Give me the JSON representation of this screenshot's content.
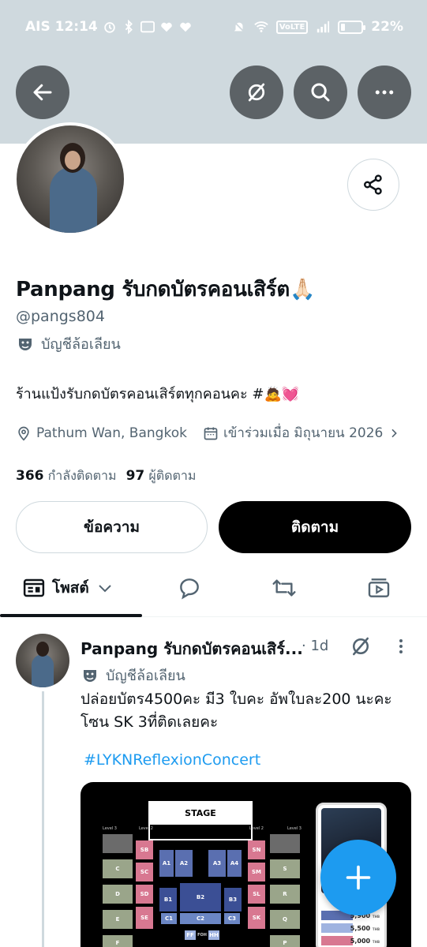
{
  "status_bar": {
    "carrier_time": "AIS 12:14",
    "battery": "22%",
    "battery_level": 0.22,
    "volte": "VoLTE"
  },
  "header": {
    "back_icon": "arrow-left-icon",
    "grok_icon": "grok-slash-icon",
    "search_icon": "search-icon",
    "more_icon": "more-horizontal-icon",
    "banner_color": "#cfd9de"
  },
  "profile": {
    "name": "Panpang รับกดบัตรคอนเสิร์ต🙏🏻",
    "handle": "@pangs804",
    "parody_label": "บัญชีล้อเลียน",
    "bio": "ร้านแป้งรับกดบัตรคอนเสิร์ตทุกคอนคะ #🙇💓",
    "location": "Pathum Wan, Bangkok",
    "joined": "เข้าร่วมเมื่อ มิถุนายน 2026",
    "following_count": "366",
    "following_label": "กำลังติดตาม",
    "followers_count": "97",
    "followers_label": "ผู้ติดตาม",
    "message_button": "ข้อความ",
    "follow_button": "ติดตาม"
  },
  "tabs": {
    "posts_label": "โพสต์"
  },
  "post": {
    "author": "Panpang รับกดบัตรคอนเสิร์...",
    "time": "· 1d",
    "parody_label": "บัญชีล้อเลียน",
    "text": "ปล่อยบัตร4500คะ มี3 ใบคะ อัพใบละ200 นะคะโซน SK 3ที่ติดเลยคะ",
    "hashtag": "#LYKNReflexionConcert",
    "media": {
      "stage_label": "STAGE",
      "zones_left": [
        "SB",
        "SC",
        "SD",
        "SE"
      ],
      "zones_right": [
        "SN",
        "SM",
        "SL",
        "SK"
      ],
      "zones_outer_left": [
        "C",
        "D",
        "E",
        "F"
      ],
      "zones_outer_right": [
        "S",
        "R",
        "Q",
        "P"
      ],
      "zones_center": [
        "A1",
        "A2",
        "A3",
        "A4",
        "B1",
        "B2",
        "B3",
        "C1",
        "C2",
        "C3"
      ],
      "floor_labels": [
        "FF",
        "FOH",
        "HH"
      ],
      "level_labels": [
        "Level 3",
        "Level 2",
        "Level 2",
        "Level 3"
      ],
      "prices": [
        "5,900",
        "5,500",
        "5,000"
      ],
      "price_unit": "THB"
    }
  },
  "fab": {
    "icon": "plus-icon",
    "color": "#1d9bf0"
  }
}
